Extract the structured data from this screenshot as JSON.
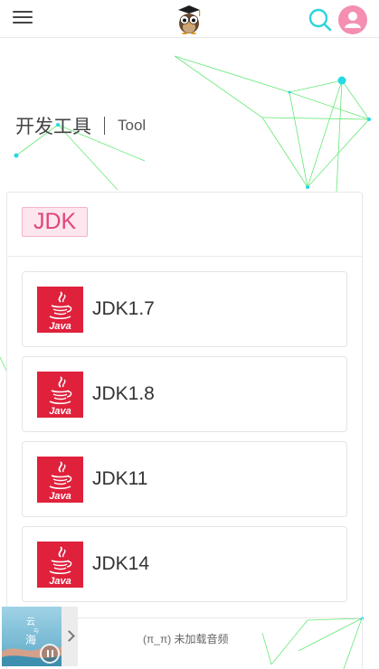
{
  "header": {
    "menu_icon": "hamburger-menu-icon",
    "logo_icon": "owl-graduate-logo",
    "search_icon": "search-icon",
    "avatar_icon": "user-avatar-icon",
    "accent": "#2ad6dd",
    "avatar_color": "#f48fb1"
  },
  "page": {
    "title_zh": "开发工具",
    "title_en": "Tool"
  },
  "category": {
    "tag": "JDK",
    "tag_color": "#e0447a",
    "items": [
      {
        "label": "JDK1.7",
        "icon": "java-icon"
      },
      {
        "label": "JDK1.8",
        "icon": "java-icon"
      },
      {
        "label": "JDK11",
        "icon": "java-icon"
      },
      {
        "label": "JDK14",
        "icon": "java-icon"
      }
    ]
  },
  "player": {
    "status": "(π_π) 未加载音频",
    "cover_icon": "album-cover-image",
    "pause_icon": "pause-icon",
    "expand_icon": "chevron-right-icon"
  }
}
